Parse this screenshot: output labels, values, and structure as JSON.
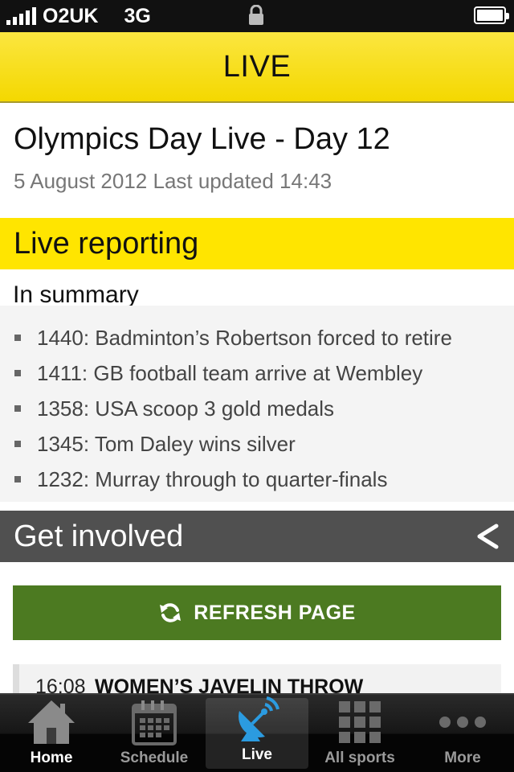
{
  "status": {
    "carrier": "O2UK",
    "network": "3G"
  },
  "header": {
    "title": "LIVE"
  },
  "article": {
    "title": "Olympics Day Live - Day 12",
    "date": "5 August 2012 Last updated 14:43"
  },
  "live_banner": "Live reporting",
  "summary": {
    "heading": "In summary",
    "items": [
      "1440: Badminton’s Robertson forced to retire",
      "1411: GB football team arrive at Wembley",
      "1358: USA scoop 3 gold medals",
      "1345: Tom Daley wins silver",
      "1232: Murray through to quarter-finals"
    ]
  },
  "involved": {
    "label": "Get involved",
    "icon": "share-icon"
  },
  "refresh": {
    "label": "REFRESH PAGE",
    "icon": "refresh-icon"
  },
  "entry": {
    "time": "16:08",
    "title": "WOMEN’S JAVELIN THROW"
  },
  "tabs": [
    {
      "label": "Home",
      "icon": "home-icon"
    },
    {
      "label": "Schedule",
      "icon": "calendar-icon"
    },
    {
      "label": "Live",
      "icon": "satellite-dish-icon"
    },
    {
      "label": "All sports",
      "icon": "grid-icon"
    },
    {
      "label": "More",
      "icon": "more-icon"
    }
  ],
  "active_tab": "Live",
  "colors": {
    "header_yellow": "#ffe500",
    "refresh_green": "#4c7a21",
    "involved_grey": "#505050",
    "tab_active_blue": "#2b9be0"
  }
}
